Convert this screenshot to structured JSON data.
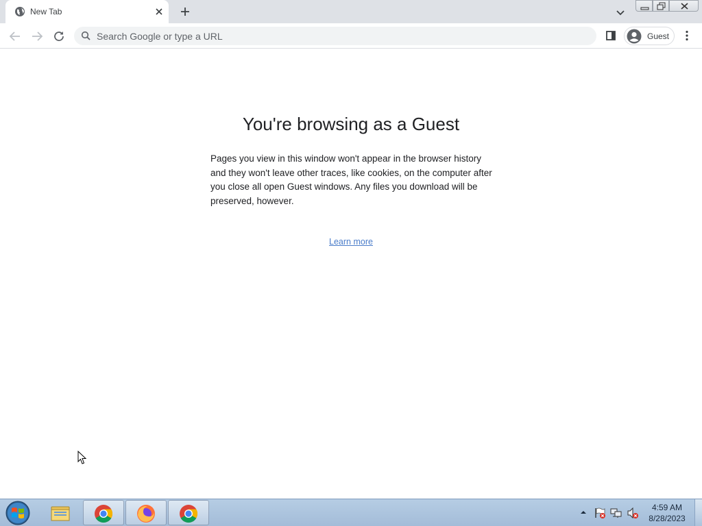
{
  "tab": {
    "title": "New Tab",
    "favicon": "globe-icon",
    "close_icon": "close-icon"
  },
  "tabstrip": {
    "new_tab_icon": "plus-icon",
    "tab_search_icon": "chevron-down-icon"
  },
  "window_controls": [
    "minimize-icon",
    "restore-icon",
    "close-icon"
  ],
  "toolbar": {
    "back_icon": "arrow-left-icon",
    "forward_icon": "arrow-right-icon",
    "reload_icon": "reload-icon",
    "omnibox_placeholder": "Search Google or type a URL",
    "side_panel_icon": "side-panel-icon",
    "profile_label": "Guest",
    "menu_icon": "more-vertical-icon"
  },
  "content": {
    "heading": "You're browsing as a Guest",
    "body": "Pages you view in this window won't appear in the browser history and they won't leave other traces, like cookies, on the computer after you close all open Guest windows. Any files you download will be preserved, however.",
    "learn_more": "Learn more"
  },
  "taskbar": {
    "start_icon": "windows-start-icon",
    "apps": [
      {
        "name": "file-explorer",
        "icon": "folder-icon",
        "active": false
      },
      {
        "name": "chrome",
        "icon": "chrome-icon",
        "active": true
      },
      {
        "name": "firefox",
        "icon": "firefox-icon",
        "active": true
      },
      {
        "name": "chrome",
        "icon": "chrome-icon",
        "active": true
      }
    ],
    "tray_icons": [
      "show-hidden-icons-icon",
      "action-center-flag-icon",
      "network-icon",
      "volume-muted-icon"
    ],
    "time": "4:59 AM",
    "date": "8/28/2023"
  },
  "colors": {
    "tabstrip_bg": "#dee1e6",
    "omnibox_bg": "#f1f3f4",
    "link": "#4a7cc9",
    "taskbar_bg": "#a9c1dc"
  }
}
